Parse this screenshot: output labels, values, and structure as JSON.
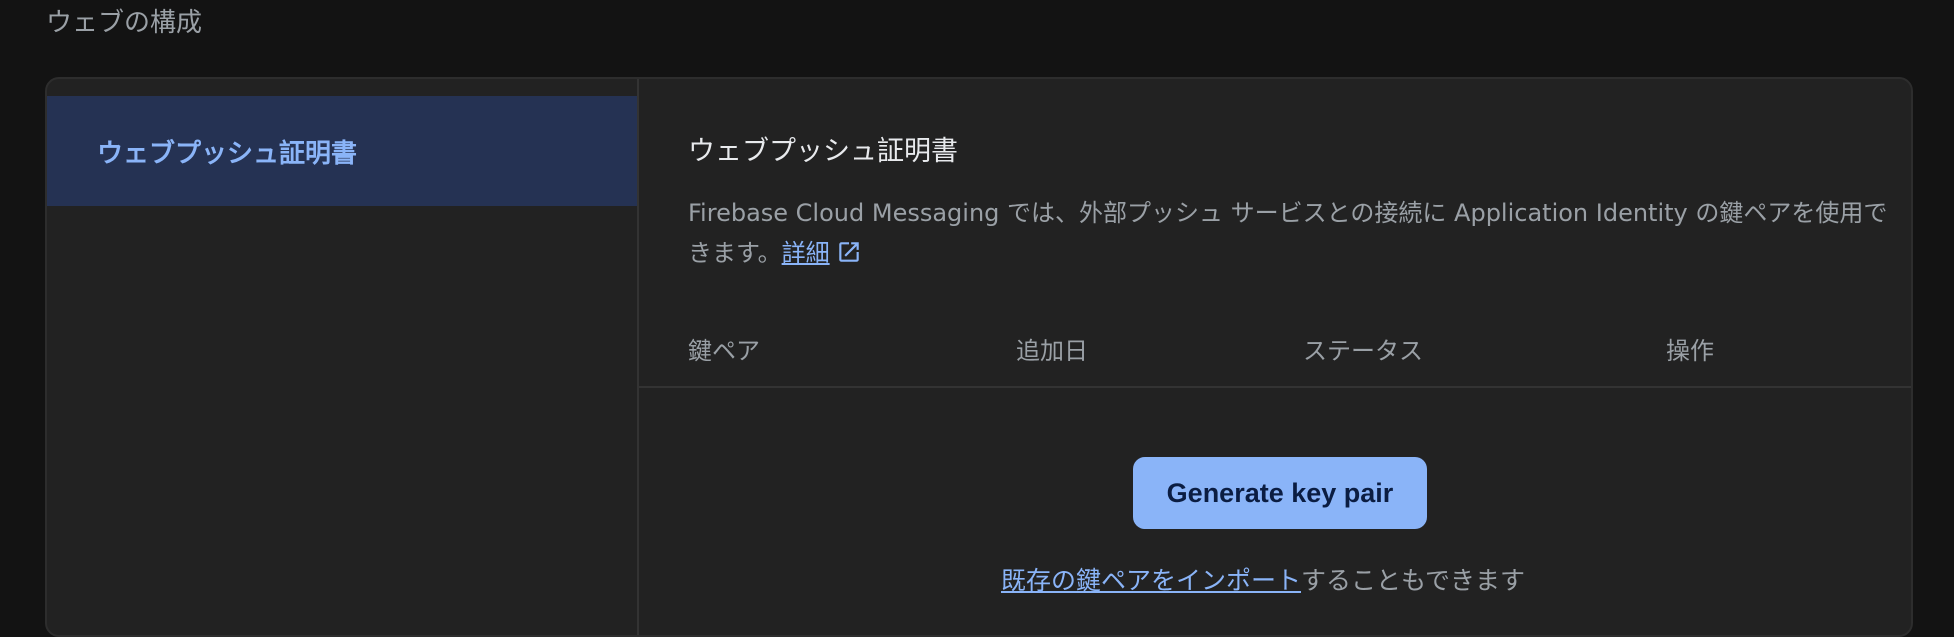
{
  "page": {
    "heading": "ウェブの構成"
  },
  "sidebar": {
    "items": [
      {
        "label": "ウェブプッシュ証明書",
        "selected": true
      }
    ]
  },
  "main": {
    "title": "ウェブプッシュ証明書",
    "description": "Firebase Cloud Messaging では、外部プッシュ サービスとの接続に Application Identity の鍵ペアを使用できます。",
    "learn_more_label": "詳細",
    "table": {
      "columns": [
        "鍵ペア",
        "追加日",
        "ステータス",
        "操作"
      ]
    },
    "generate_button_label": "Generate key pair",
    "import_link_label": "既存の鍵ペアをインポート",
    "import_suffix": "することもできます"
  },
  "colors": {
    "background": "#131313",
    "card": "#222222",
    "accent": "#8ab4f8",
    "selected_bg": "#253253",
    "muted_text": "#9aa0a6"
  },
  "icons": {
    "external_link": "open-in-new-icon"
  }
}
